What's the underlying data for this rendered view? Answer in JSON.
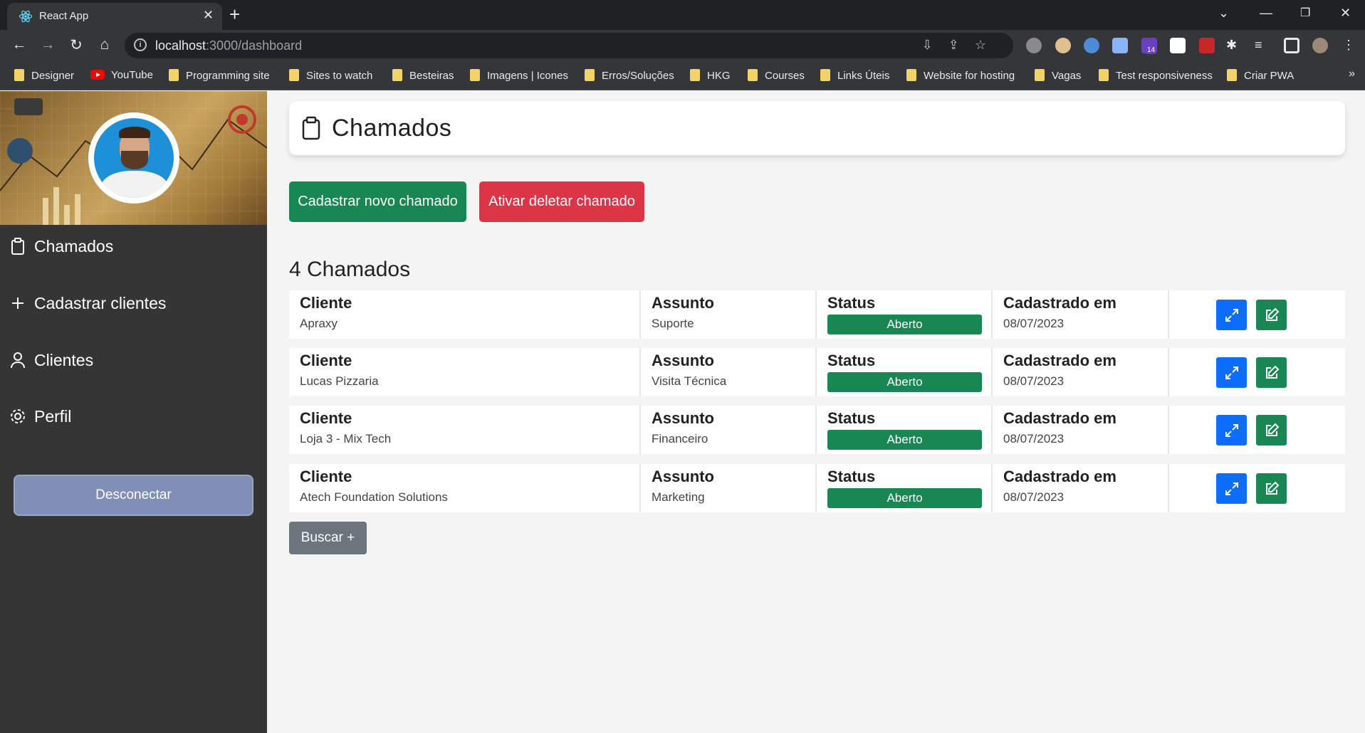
{
  "browser": {
    "tab_title": "React App",
    "tab_close": "✕",
    "new_tab": "+",
    "url_host": "localhost",
    "url_rest": ":3000/dashboard",
    "bookmarks": [
      {
        "label": "Designer",
        "icon": "folder"
      },
      {
        "label": "YouTube",
        "icon": "youtube"
      },
      {
        "label": "Programming site",
        "icon": "folder"
      },
      {
        "label": "Sites to watch",
        "icon": "folder"
      },
      {
        "label": "Besteiras",
        "icon": "folder"
      },
      {
        "label": "Imagens | Icones",
        "icon": "folder"
      },
      {
        "label": "Erros/Soluções",
        "icon": "folder"
      },
      {
        "label": "HKG",
        "icon": "folder"
      },
      {
        "label": "Courses",
        "icon": "folder"
      },
      {
        "label": "Links Úteis",
        "icon": "folder"
      },
      {
        "label": "Website for hosting",
        "icon": "folder"
      },
      {
        "label": "Vagas",
        "icon": "folder"
      },
      {
        "label": "Test responsiveness",
        "icon": "folder"
      },
      {
        "label": "Criar PWA",
        "icon": "folder"
      }
    ],
    "bookmarks_more": "»",
    "extension_badge": "14"
  },
  "sidebar": {
    "menu": [
      {
        "label": "Chamados",
        "icon": "clipboard-icon"
      },
      {
        "label": "Cadastrar clientes",
        "icon": "plus-icon"
      },
      {
        "label": "Clientes",
        "icon": "user-icon"
      },
      {
        "label": "Perfil",
        "icon": "gear-icon"
      }
    ],
    "logout_label": "Desconectar"
  },
  "main": {
    "title": "Chamados",
    "new_ticket_label": "Cadastrar novo chamado",
    "delete_ticket_label": "Ativar deletar chamado",
    "count_label": "4 Chamados",
    "columns": {
      "cliente": "Cliente",
      "assunto": "Assunto",
      "status": "Status",
      "cadastrado": "Cadastrado em"
    },
    "tickets": [
      {
        "cliente": "Apraxy",
        "assunto": "Suporte",
        "status": "Aberto",
        "data": "08/07/2023"
      },
      {
        "cliente": "Lucas Pizzaria",
        "assunto": "Visita Técnica",
        "status": "Aberto",
        "data": "08/07/2023"
      },
      {
        "cliente": "Loja 3 - Mix Tech",
        "assunto": "Financeiro",
        "status": "Aberto",
        "data": "08/07/2023"
      },
      {
        "cliente": "Atech Foundation Solutions",
        "assunto": "Marketing",
        "status": "Aberto",
        "data": "08/07/2023"
      }
    ],
    "search_label": "Buscar +"
  },
  "colors": {
    "sidebar_bg": "#353535",
    "success": "#198754",
    "danger": "#dc3545",
    "primary": "#0d6efd",
    "secondary": "#6c757d",
    "logout": "#7f8fb6"
  }
}
